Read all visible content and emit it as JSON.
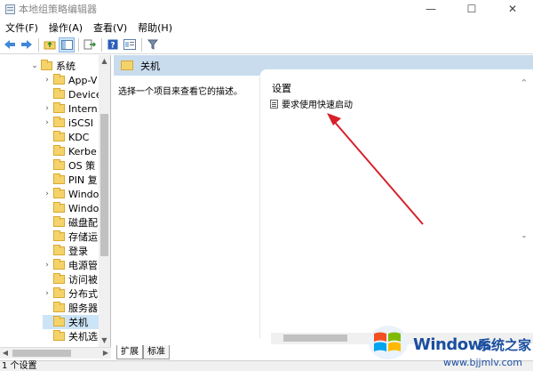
{
  "window": {
    "title": "本地组策略编辑器",
    "controls": [
      "—",
      "☐",
      "✕"
    ]
  },
  "menu": [
    "文件(F)",
    "操作(A)",
    "查看(V)",
    "帮助(H)"
  ],
  "tree": {
    "items": [
      {
        "label": "系统",
        "chev": "⌄"
      },
      {
        "label": "App-V",
        "chev": "›"
      },
      {
        "label": "Device",
        "chev": ""
      },
      {
        "label": "Intern",
        "chev": "›"
      },
      {
        "label": "iSCSI",
        "chev": "›"
      },
      {
        "label": "KDC",
        "chev": ""
      },
      {
        "label": "Kerbe",
        "chev": ""
      },
      {
        "label": "OS 策",
        "chev": ""
      },
      {
        "label": "PIN 复",
        "chev": ""
      },
      {
        "label": "Windo",
        "chev": "›"
      },
      {
        "label": "Windo",
        "chev": ""
      },
      {
        "label": "磁盘配",
        "chev": ""
      },
      {
        "label": "存储运",
        "chev": ""
      },
      {
        "label": "登录",
        "chev": ""
      },
      {
        "label": "电源管",
        "chev": "›"
      },
      {
        "label": "访问被",
        "chev": ""
      },
      {
        "label": "分布式",
        "chev": "›"
      },
      {
        "label": "服务器",
        "chev": ""
      },
      {
        "label": "关机",
        "chev": ""
      },
      {
        "label": "关机选",
        "chev": ""
      }
    ],
    "selected_index": 18
  },
  "right": {
    "header": "关机",
    "description": "选择一个项目来查看它的描述。",
    "column_header": "设置",
    "settings": [
      "要求使用快速启动"
    ]
  },
  "tabs": [
    "扩展",
    "标准"
  ],
  "status": "1 个设置",
  "watermark": {
    "brand": "Windows",
    "brand_cn": "系统之家",
    "url": "www.bjjmlv.com"
  },
  "colors": {
    "header_bg": "#c9dcee",
    "arrow": "#d8202a",
    "selection": "#cce4f7",
    "brand": "#1b4fa0"
  }
}
